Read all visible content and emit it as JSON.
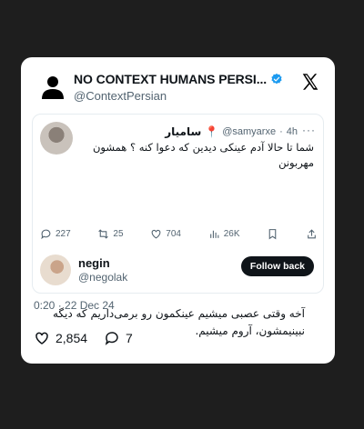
{
  "author": {
    "name": "NO CONTEXT HUMANS PERSI...",
    "handle": "@ContextPersian"
  },
  "quoted": {
    "name": "سامیار",
    "pin": "📍",
    "handle": "@samyarxe",
    "sep": "·",
    "age": "4h",
    "more": "···",
    "text": "شما تا حالا آدم عینکی دیدین که دعوا کنه ؟ همشون مهربونن",
    "actions": {
      "replies": "227",
      "retweets": "25",
      "likes": "704",
      "views": "26K"
    }
  },
  "reply": {
    "name": "negin",
    "handle": "@negolak",
    "follow_label": "Follow back",
    "text": "آخه وقتی عصبی میشیم عینکمون رو برمی‌داریم که دیگه نبینیمشون، آروم میشیم."
  },
  "meta": {
    "timestamp": "0:20 · 22 Dec 24"
  },
  "stats": {
    "likes": "2,854",
    "comments": "7"
  },
  "colors": {
    "verified": "#1d9bf0",
    "pin": "#d5392b",
    "muted": "#536471"
  }
}
